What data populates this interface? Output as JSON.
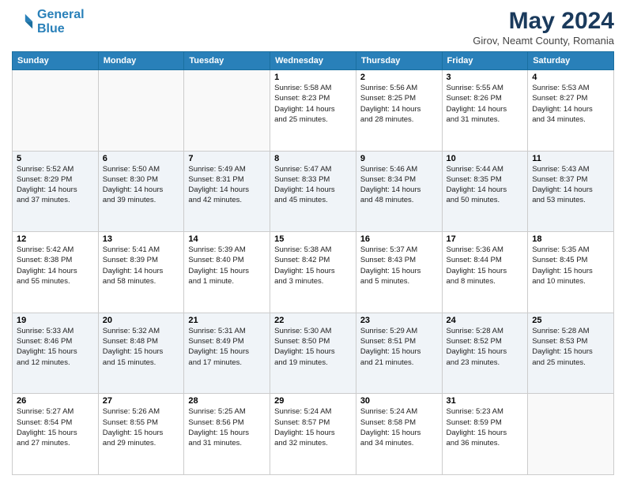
{
  "header": {
    "logo_line1": "General",
    "logo_line2": "Blue",
    "month_year": "May 2024",
    "location": "Girov, Neamt County, Romania"
  },
  "weekdays": [
    "Sunday",
    "Monday",
    "Tuesday",
    "Wednesday",
    "Thursday",
    "Friday",
    "Saturday"
  ],
  "weeks": [
    [
      {
        "day": "",
        "info": ""
      },
      {
        "day": "",
        "info": ""
      },
      {
        "day": "",
        "info": ""
      },
      {
        "day": "1",
        "info": "Sunrise: 5:58 AM\nSunset: 8:23 PM\nDaylight: 14 hours\nand 25 minutes."
      },
      {
        "day": "2",
        "info": "Sunrise: 5:56 AM\nSunset: 8:25 PM\nDaylight: 14 hours\nand 28 minutes."
      },
      {
        "day": "3",
        "info": "Sunrise: 5:55 AM\nSunset: 8:26 PM\nDaylight: 14 hours\nand 31 minutes."
      },
      {
        "day": "4",
        "info": "Sunrise: 5:53 AM\nSunset: 8:27 PM\nDaylight: 14 hours\nand 34 minutes."
      }
    ],
    [
      {
        "day": "5",
        "info": "Sunrise: 5:52 AM\nSunset: 8:29 PM\nDaylight: 14 hours\nand 37 minutes."
      },
      {
        "day": "6",
        "info": "Sunrise: 5:50 AM\nSunset: 8:30 PM\nDaylight: 14 hours\nand 39 minutes."
      },
      {
        "day": "7",
        "info": "Sunrise: 5:49 AM\nSunset: 8:31 PM\nDaylight: 14 hours\nand 42 minutes."
      },
      {
        "day": "8",
        "info": "Sunrise: 5:47 AM\nSunset: 8:33 PM\nDaylight: 14 hours\nand 45 minutes."
      },
      {
        "day": "9",
        "info": "Sunrise: 5:46 AM\nSunset: 8:34 PM\nDaylight: 14 hours\nand 48 minutes."
      },
      {
        "day": "10",
        "info": "Sunrise: 5:44 AM\nSunset: 8:35 PM\nDaylight: 14 hours\nand 50 minutes."
      },
      {
        "day": "11",
        "info": "Sunrise: 5:43 AM\nSunset: 8:37 PM\nDaylight: 14 hours\nand 53 minutes."
      }
    ],
    [
      {
        "day": "12",
        "info": "Sunrise: 5:42 AM\nSunset: 8:38 PM\nDaylight: 14 hours\nand 55 minutes."
      },
      {
        "day": "13",
        "info": "Sunrise: 5:41 AM\nSunset: 8:39 PM\nDaylight: 14 hours\nand 58 minutes."
      },
      {
        "day": "14",
        "info": "Sunrise: 5:39 AM\nSunset: 8:40 PM\nDaylight: 15 hours\nand 1 minute."
      },
      {
        "day": "15",
        "info": "Sunrise: 5:38 AM\nSunset: 8:42 PM\nDaylight: 15 hours\nand 3 minutes."
      },
      {
        "day": "16",
        "info": "Sunrise: 5:37 AM\nSunset: 8:43 PM\nDaylight: 15 hours\nand 5 minutes."
      },
      {
        "day": "17",
        "info": "Sunrise: 5:36 AM\nSunset: 8:44 PM\nDaylight: 15 hours\nand 8 minutes."
      },
      {
        "day": "18",
        "info": "Sunrise: 5:35 AM\nSunset: 8:45 PM\nDaylight: 15 hours\nand 10 minutes."
      }
    ],
    [
      {
        "day": "19",
        "info": "Sunrise: 5:33 AM\nSunset: 8:46 PM\nDaylight: 15 hours\nand 12 minutes."
      },
      {
        "day": "20",
        "info": "Sunrise: 5:32 AM\nSunset: 8:48 PM\nDaylight: 15 hours\nand 15 minutes."
      },
      {
        "day": "21",
        "info": "Sunrise: 5:31 AM\nSunset: 8:49 PM\nDaylight: 15 hours\nand 17 minutes."
      },
      {
        "day": "22",
        "info": "Sunrise: 5:30 AM\nSunset: 8:50 PM\nDaylight: 15 hours\nand 19 minutes."
      },
      {
        "day": "23",
        "info": "Sunrise: 5:29 AM\nSunset: 8:51 PM\nDaylight: 15 hours\nand 21 minutes."
      },
      {
        "day": "24",
        "info": "Sunrise: 5:28 AM\nSunset: 8:52 PM\nDaylight: 15 hours\nand 23 minutes."
      },
      {
        "day": "25",
        "info": "Sunrise: 5:28 AM\nSunset: 8:53 PM\nDaylight: 15 hours\nand 25 minutes."
      }
    ],
    [
      {
        "day": "26",
        "info": "Sunrise: 5:27 AM\nSunset: 8:54 PM\nDaylight: 15 hours\nand 27 minutes."
      },
      {
        "day": "27",
        "info": "Sunrise: 5:26 AM\nSunset: 8:55 PM\nDaylight: 15 hours\nand 29 minutes."
      },
      {
        "day": "28",
        "info": "Sunrise: 5:25 AM\nSunset: 8:56 PM\nDaylight: 15 hours\nand 31 minutes."
      },
      {
        "day": "29",
        "info": "Sunrise: 5:24 AM\nSunset: 8:57 PM\nDaylight: 15 hours\nand 32 minutes."
      },
      {
        "day": "30",
        "info": "Sunrise: 5:24 AM\nSunset: 8:58 PM\nDaylight: 15 hours\nand 34 minutes."
      },
      {
        "day": "31",
        "info": "Sunrise: 5:23 AM\nSunset: 8:59 PM\nDaylight: 15 hours\nand 36 minutes."
      },
      {
        "day": "",
        "info": ""
      }
    ]
  ]
}
